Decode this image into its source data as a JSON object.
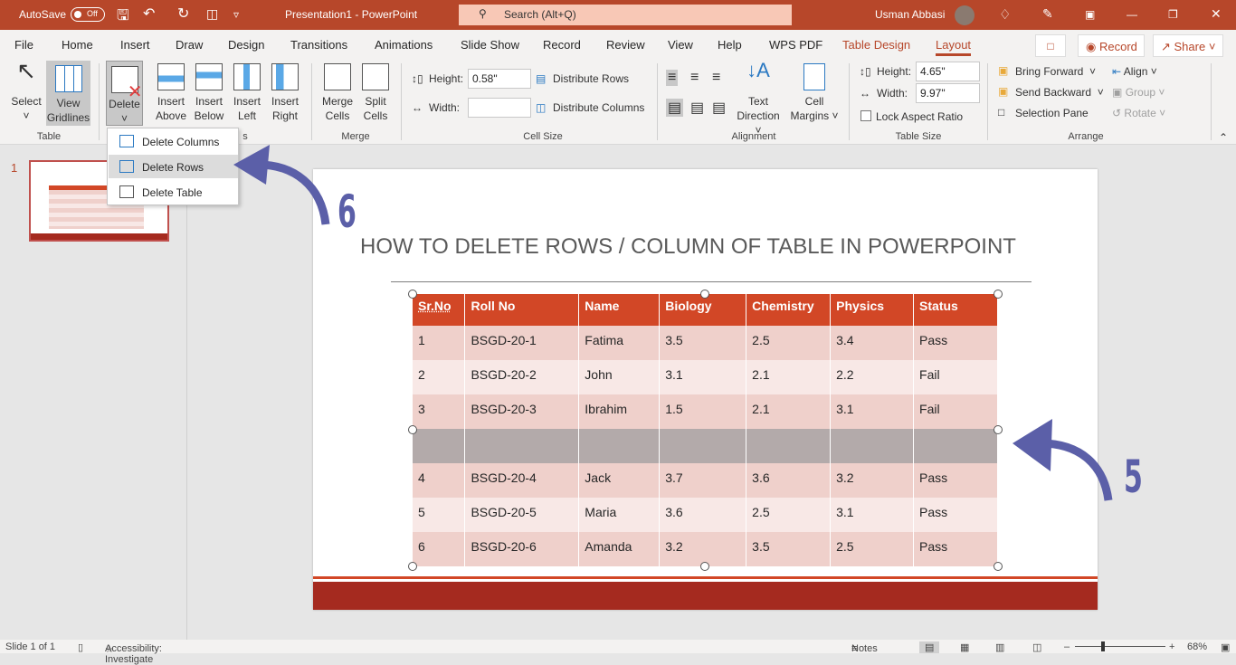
{
  "titlebar": {
    "autosave": "AutoSave",
    "autosave_state": "Off",
    "doc_title": "Presentation1  -  PowerPoint",
    "search_placeholder": "Search (Alt+Q)",
    "user": "Usman Abbasi"
  },
  "tabs": [
    "File",
    "Home",
    "Insert",
    "Draw",
    "Design",
    "Transitions",
    "Animations",
    "Slide Show",
    "Record",
    "Review",
    "View",
    "Help",
    "WPS PDF",
    "Table Design",
    "Layout"
  ],
  "active_tab": "Layout",
  "right_buttons": {
    "record": "Record",
    "share": "Share"
  },
  "ribbon": {
    "table": {
      "select": "Select",
      "view_gridlines_1": "View",
      "view_gridlines_2": "Gridlines",
      "label": "Table"
    },
    "rows_cols": {
      "delete": "Delete",
      "insert_above_1": "Insert",
      "insert_above_2": "Above",
      "insert_below_1": "Insert",
      "insert_below_2": "Below",
      "insert_left_1": "Insert",
      "insert_left_2": "Left",
      "insert_right_1": "Insert",
      "insert_right_2": "Right",
      "label_tail": "s"
    },
    "merge": {
      "merge_1": "Merge",
      "merge_2": "Cells",
      "split_1": "Split",
      "split_2": "Cells",
      "label": "Merge"
    },
    "cell_size": {
      "height_label": "Height:",
      "height_value": "0.58\"",
      "width_label": "Width:",
      "width_value": "",
      "distribute_rows": "Distribute Rows",
      "distribute_columns": "Distribute Columns",
      "label": "Cell Size"
    },
    "alignment": {
      "text_direction_1": "Text",
      "text_direction_2": "Direction",
      "cell_margins_1": "Cell",
      "cell_margins_2": "Margins",
      "label": "Alignment"
    },
    "table_size": {
      "height_label": "Height:",
      "height_value": "4.65\"",
      "width_label": "Width:",
      "width_value": "9.97\"",
      "lock_aspect": "Lock Aspect Ratio",
      "label": "Table Size"
    },
    "arrange": {
      "bring_forward": "Bring Forward",
      "send_backward": "Send Backward",
      "selection_pane": "Selection Pane",
      "align": "Align",
      "group": "Group",
      "rotate": "Rotate",
      "label": "Arrange"
    }
  },
  "delete_menu": [
    "Delete Columns",
    "Delete Rows",
    "Delete Table"
  ],
  "thumbnail_number": "1",
  "slide": {
    "title": "HOW TO DELETE  ROWS / COLUMN OF TABLE IN POWERPOINT",
    "table": {
      "headers": [
        "Sr.No",
        "Roll No",
        "Name",
        "Biology",
        "Chemistry",
        "Physics",
        "Status"
      ],
      "rows": [
        [
          "1",
          "BSGD-20-1",
          "Fatima",
          "3.5",
          "2.5",
          "3.4",
          "Pass"
        ],
        [
          "2",
          "BSGD-20-2",
          "John",
          "3.1",
          "2.1",
          "2.2",
          "Fail"
        ],
        [
          "3",
          "BSGD-20-3",
          "Ibrahim",
          "1.5",
          "2.1",
          "3.1",
          "Fail"
        ],
        [
          "",
          "",
          "",
          "",
          "",
          "",
          ""
        ],
        [
          "4",
          "BSGD-20-4",
          "Jack",
          "3.7",
          "3.6",
          "3.2",
          "Pass"
        ],
        [
          "5",
          "BSGD-20-5",
          "Maria",
          "3.6",
          "2.5",
          "3.1",
          "Pass"
        ],
        [
          "6",
          "BSGD-20-6",
          "Amanda",
          "3.2",
          "3.5",
          "2.5",
          "Pass"
        ]
      ]
    }
  },
  "annotations": {
    "step_a": "6",
    "step_b": "5"
  },
  "status": {
    "slide": "Slide 1 of 1",
    "accessibility": "Accessibility: Investigate",
    "notes": "Notes",
    "zoom": "68%"
  },
  "colors": {
    "brand": "#b7472a",
    "header": "#d24726",
    "annotation": "#5b5fa8"
  }
}
